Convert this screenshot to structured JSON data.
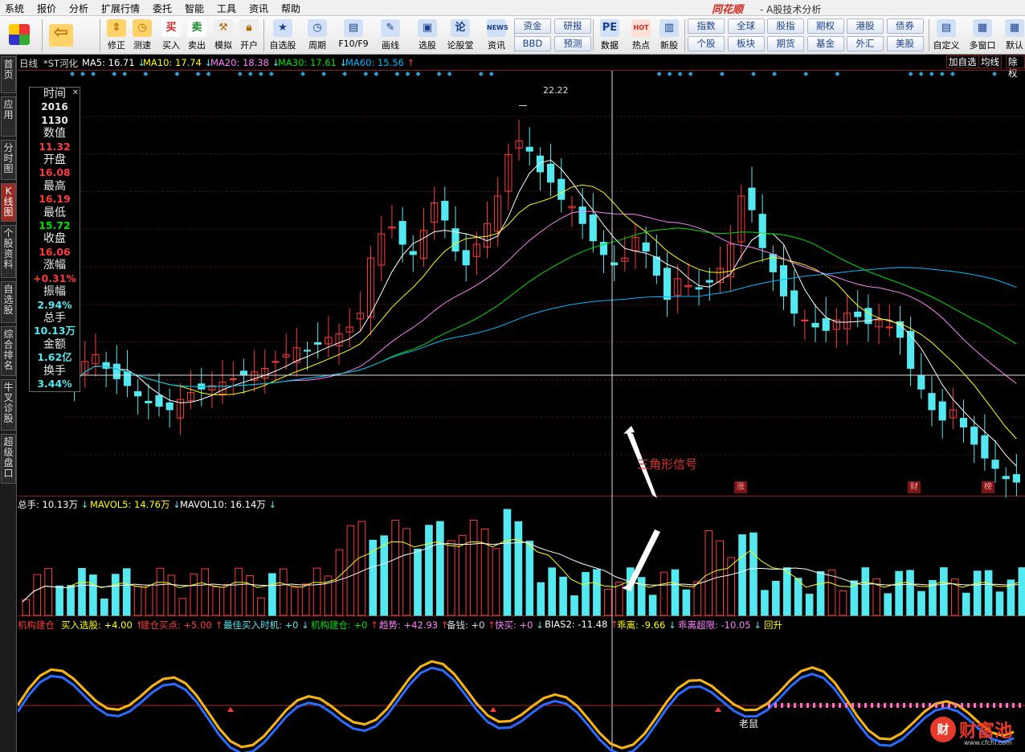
{
  "menu": [
    "系统",
    "报价",
    "分析",
    "扩展行情",
    "委托",
    "智能",
    "工具",
    "资讯",
    "帮助"
  ],
  "brand": "同花顺",
  "app_title": "- A股技术分析",
  "toolbar": {
    "buttons": [
      {
        "label": "",
        "icon": "layout-icon"
      },
      {
        "label": "",
        "icon": "back-arrow-icon"
      },
      {
        "label": "修正",
        "icon": "up-down-arrows-icon"
      },
      {
        "label": "测速",
        "icon": "clock-icon"
      },
      {
        "label": "买入",
        "icon": "buy-icon",
        "glyph": "买"
      },
      {
        "label": "卖出",
        "icon": "sell-icon",
        "glyph": "卖"
      },
      {
        "label": "模拟",
        "icon": "hammer-icon"
      },
      {
        "label": "开户",
        "icon": "lock-icon"
      },
      {
        "label": "自选股",
        "icon": "star-folder-icon"
      },
      {
        "label": "周期",
        "icon": "period-clock-icon"
      },
      {
        "label": "F10/F9",
        "icon": "f10-icon"
      },
      {
        "label": "画线",
        "icon": "pencil-icon"
      },
      {
        "label": "选股",
        "icon": "screen-icon"
      },
      {
        "label": "论股堂",
        "icon": "forum-icon"
      },
      {
        "label": "资讯",
        "icon": "news-icon",
        "glyph": "NEWS"
      },
      {
        "label": "数据",
        "icon": "pe-icon",
        "glyph": "PE"
      },
      {
        "label": "热点",
        "icon": "hot-icon",
        "glyph": "HOT"
      },
      {
        "label": "新股",
        "icon": "new-stock-icon"
      },
      {
        "label": "自定义",
        "icon": "customize-icon"
      },
      {
        "label": "多窗口",
        "icon": "multi-window-icon"
      },
      {
        "label": "默认",
        "icon": "default-icon"
      }
    ],
    "grid1": [
      "资金",
      "研报",
      "BBD",
      "预测"
    ],
    "grid2": [
      "指数",
      "全球",
      "股指",
      "期权",
      "港股",
      "债券",
      "个股",
      "板块",
      "期货",
      "基金",
      "外汇",
      "美股"
    ]
  },
  "left_tabs": [
    "首页",
    "应用",
    "分时图",
    "K线图",
    "个股资料",
    "自选股",
    "综合排名",
    "牛叉诊股",
    "超级盘口"
  ],
  "main_header": {
    "period": "日线",
    "stock": "*ST河化",
    "ma5": "MA5: 16.71",
    "ma10": "MA10: 17.74",
    "ma20": "MA20: 18.38",
    "ma30": "MA30: 17.61",
    "ma60": "MA60: 15.56",
    "buttons": [
      "加自选",
      "均线",
      "除权"
    ]
  },
  "info_panel": {
    "time_label": "时间",
    "date_year": "2016",
    "date_md": "1130",
    "value_label": "数值",
    "value": "11.32",
    "open_label": "开盘",
    "open": "16.08",
    "high_label": "最高",
    "high": "16.19",
    "low_label": "最低",
    "low": "15.72",
    "close_label": "收盘",
    "close": "16.06",
    "change_label": "涨幅",
    "change": "+0.31%",
    "amplitude_label": "振幅",
    "amplitude": "2.94%",
    "volume_label": "总手",
    "volume": "10.13万",
    "amount_label": "金额",
    "amount": "1.62亿",
    "turnover_label": "换手",
    "turnover": "3.44%"
  },
  "peak_label": "22.22",
  "event_flags": [
    "涨",
    "财",
    "榜"
  ],
  "volume_header": {
    "vol": "总手: 10.13万",
    "mavol5": "MAVOL5: 14.76万",
    "mavol10": "MAVOL10: 16.14万"
  },
  "indicator_header": {
    "i1": "机构建仓",
    "i2": "买入选股: +4.00",
    "i3": "建仓买点: +5.00",
    "i4": "最佳买入时机: +0",
    "i5": "机构建仓: +0",
    "i6": "趋势: +42.93",
    "i7": "备钱: +0",
    "i8": "快买: +0",
    "i9": "BIAS2: -11.48",
    "i10": "乖离: -9.66",
    "i11": "乖离超限: -10.05",
    "i12": "回升"
  },
  "annotation": "三角形信号",
  "indicator_note": "老鼠",
  "watermark": {
    "logo": "财",
    "text": "财富池",
    "url": "www.cfchi.com"
  },
  "colors": {
    "up": "#ff3a3a",
    "down": "#54e8f0",
    "ma5": "#ffffff",
    "ma10": "#ffff00",
    "ma20": "#ff80ff",
    "ma30": "#00e000",
    "ma60": "#00b8ff",
    "accent": "#d6261b"
  },
  "chart_data": {
    "type": "candlestick",
    "symbol": "*ST河化",
    "period": "日线",
    "crosshair_date": "20161130",
    "peak_value": 22.22,
    "y_estimate_range": [
      11.0,
      23.0
    ],
    "close_series_estimate": [
      14.2,
      14.8,
      15.0,
      14.6,
      14.3,
      14.1,
      13.8,
      13.6,
      13.5,
      13.4,
      13.7,
      13.9,
      14.0,
      14.1,
      14.2,
      14.3,
      14.4,
      14.5,
      14.6,
      14.8,
      15.0,
      15.2,
      15.1,
      15.3,
      15.5,
      15.6,
      15.8,
      16.2,
      17.8,
      18.5,
      18.7,
      18.2,
      17.9,
      18.6,
      19.4,
      18.9,
      18.0,
      17.6,
      18.2,
      18.8,
      19.6,
      20.8,
      21.2,
      20.9,
      20.3,
      20.0,
      19.5,
      19.3,
      18.8,
      18.3,
      17.9,
      17.6,
      17.8,
      18.4,
      18.0,
      17.3,
      16.6,
      17.2,
      17.0,
      16.9,
      17.1,
      17.5,
      18.2,
      19.6,
      19.2,
      18.1,
      17.4,
      16.7,
      16.2,
      16.0,
      15.8,
      15.7,
      16.0,
      16.2,
      16.1,
      15.9,
      16.0,
      15.8,
      15.5,
      14.6,
      14.0,
      13.4,
      13.1,
      13.4,
      12.9,
      12.4,
      12.0,
      11.7,
      11.4,
      11.3
    ]
  }
}
